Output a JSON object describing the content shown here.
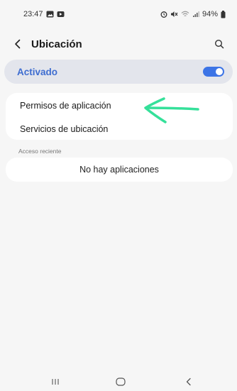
{
  "status_bar": {
    "time": "23:47",
    "battery": "94%"
  },
  "header": {
    "title": "Ubicación",
    "back_icon": "chevron-left-icon",
    "search_icon": "search-icon"
  },
  "master_switch": {
    "label": "Activado",
    "on": true,
    "accent": "#3c74e6"
  },
  "settings": {
    "items": [
      {
        "label": "Permisos de aplicación"
      },
      {
        "label": "Servicios de ubicación"
      }
    ]
  },
  "recent_access": {
    "header": "Acceso reciente",
    "empty_text": "No hay aplicaciones"
  },
  "annotation": {
    "icon": "green-arrow-icon",
    "color": "#35e09a"
  },
  "nav_bar": {
    "recents_icon": "recents-icon",
    "home_icon": "home-icon",
    "back_icon": "back-icon"
  }
}
